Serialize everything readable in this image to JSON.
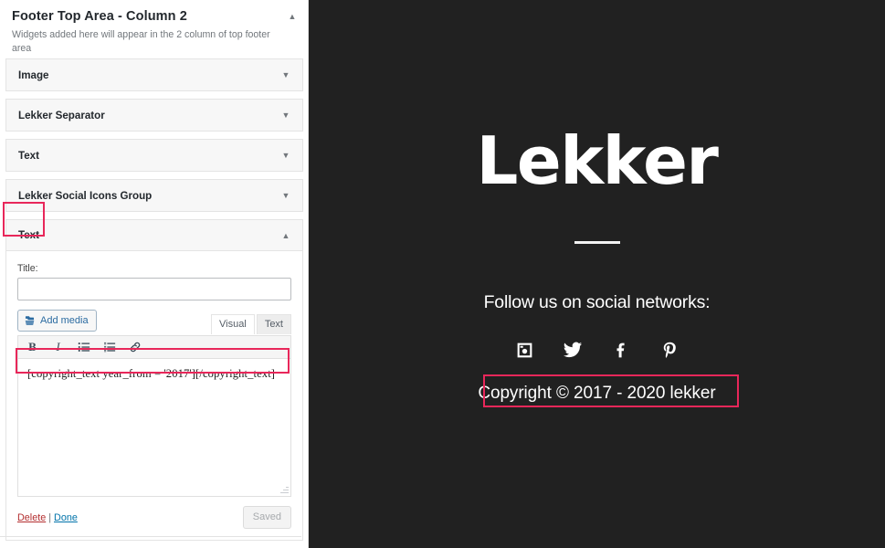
{
  "sidebar": {
    "section": {
      "title": "Footer Top Area - Column 2",
      "description": "Widgets added here will appear in the 2 column of top footer area",
      "collapse_icon": "chevron-up-icon"
    },
    "widgets": [
      {
        "name": "Image",
        "state": "collapsed",
        "icon": "chevron-down-icon"
      },
      {
        "name": "Lekker Separator",
        "state": "collapsed",
        "icon": "chevron-down-icon"
      },
      {
        "name": "Text",
        "state": "collapsed",
        "icon": "chevron-down-icon"
      },
      {
        "name": "Lekker Social Icons Group",
        "state": "collapsed",
        "icon": "chevron-down-icon"
      },
      {
        "name": "Text",
        "state": "expanded",
        "icon": "chevron-up-icon",
        "highlighted": true
      }
    ],
    "text_widget_form": {
      "title_label": "Title:",
      "title_value": "",
      "title_placeholder": "",
      "add_media_label": "Add media",
      "add_media_icon": "add-media-icon",
      "editor_tabs": [
        {
          "label": "Visual",
          "active": true
        },
        {
          "label": "Text",
          "active": false
        }
      ],
      "toolbar": [
        {
          "name": "bold-icon",
          "label": "B"
        },
        {
          "name": "italic-icon",
          "label": "I"
        },
        {
          "name": "unordered-list-icon",
          "label": ""
        },
        {
          "name": "ordered-list-icon",
          "label": ""
        },
        {
          "name": "link-icon",
          "label": ""
        }
      ],
      "content": "[copyright_text year_from = '2017'][/copyright_text]",
      "content_highlighted": true,
      "delete_label": "Delete",
      "separator": "|",
      "done_label": "Done",
      "save_button_label": "Saved",
      "save_button_state": "disabled"
    }
  },
  "preview": {
    "brand": "Lekker",
    "follow_heading": "Follow us on social networks:",
    "social_icons": [
      {
        "name": "instagram-icon",
        "label": "Instagram"
      },
      {
        "name": "twitter-icon",
        "label": "Twitter"
      },
      {
        "name": "facebook-icon",
        "label": "Facebook"
      },
      {
        "name": "pinterest-icon",
        "label": "Pinterest"
      }
    ],
    "copyright": "Copyright © 2017 - 2020 lekker",
    "copyright_highlighted": true
  },
  "colors": {
    "highlight": "#e8275a",
    "preview_background": "#212121",
    "preview_text": "#ffffff",
    "link_blue": "#0073aa",
    "link_red": "#b32d2e"
  }
}
